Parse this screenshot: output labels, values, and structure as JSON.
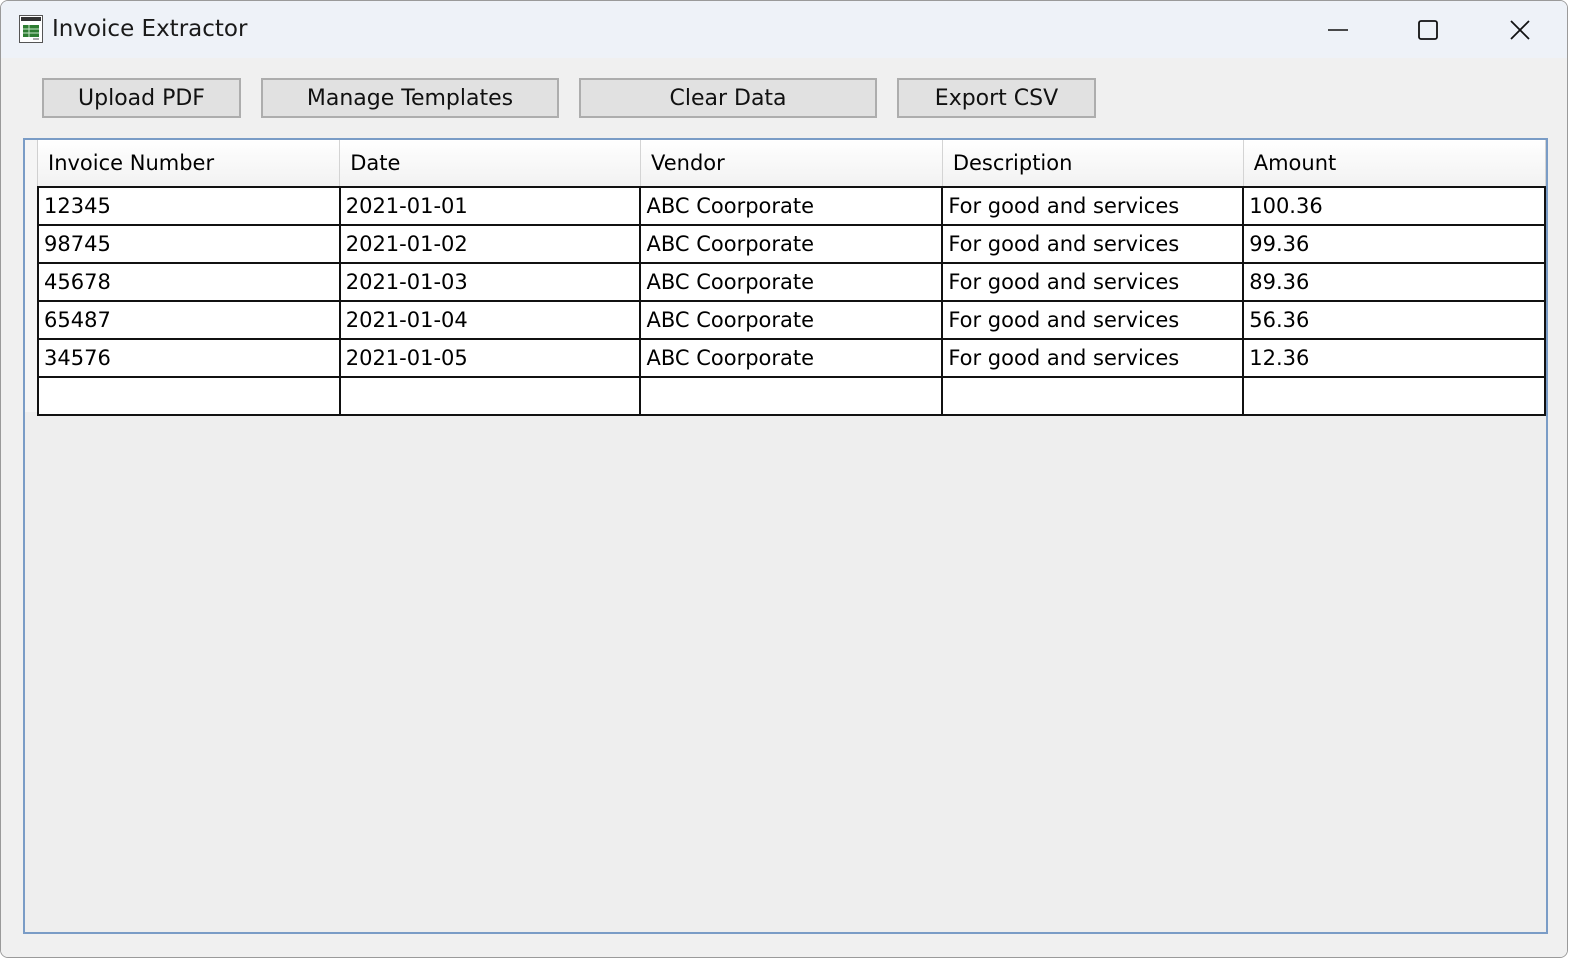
{
  "window": {
    "title": "Invoice Extractor",
    "icon": "invoice-icon"
  },
  "toolbar": {
    "upload_label": "Upload PDF",
    "templates_label": "Manage Templates",
    "clear_label": "Clear Data",
    "export_label": "Export CSV"
  },
  "table": {
    "columns": [
      "Invoice Number",
      "Date",
      "Vendor",
      "Description",
      "Amount"
    ],
    "rows": [
      [
        "12345",
        "2021-01-01",
        "ABC Coorporate",
        "For good and services",
        "100.36"
      ],
      [
        "98745",
        "2021-01-02",
        "ABC Coorporate",
        "For good and services",
        "99.36"
      ],
      [
        "45678",
        "2021-01-03",
        "ABC Coorporate",
        "For good and services",
        "89.36"
      ],
      [
        "65487",
        "2021-01-04",
        "ABC Coorporate",
        "For good and services",
        "56.36"
      ],
      [
        "34576",
        "2021-01-05",
        "ABC Coorporate",
        "For good and services",
        "12.36"
      ]
    ]
  }
}
